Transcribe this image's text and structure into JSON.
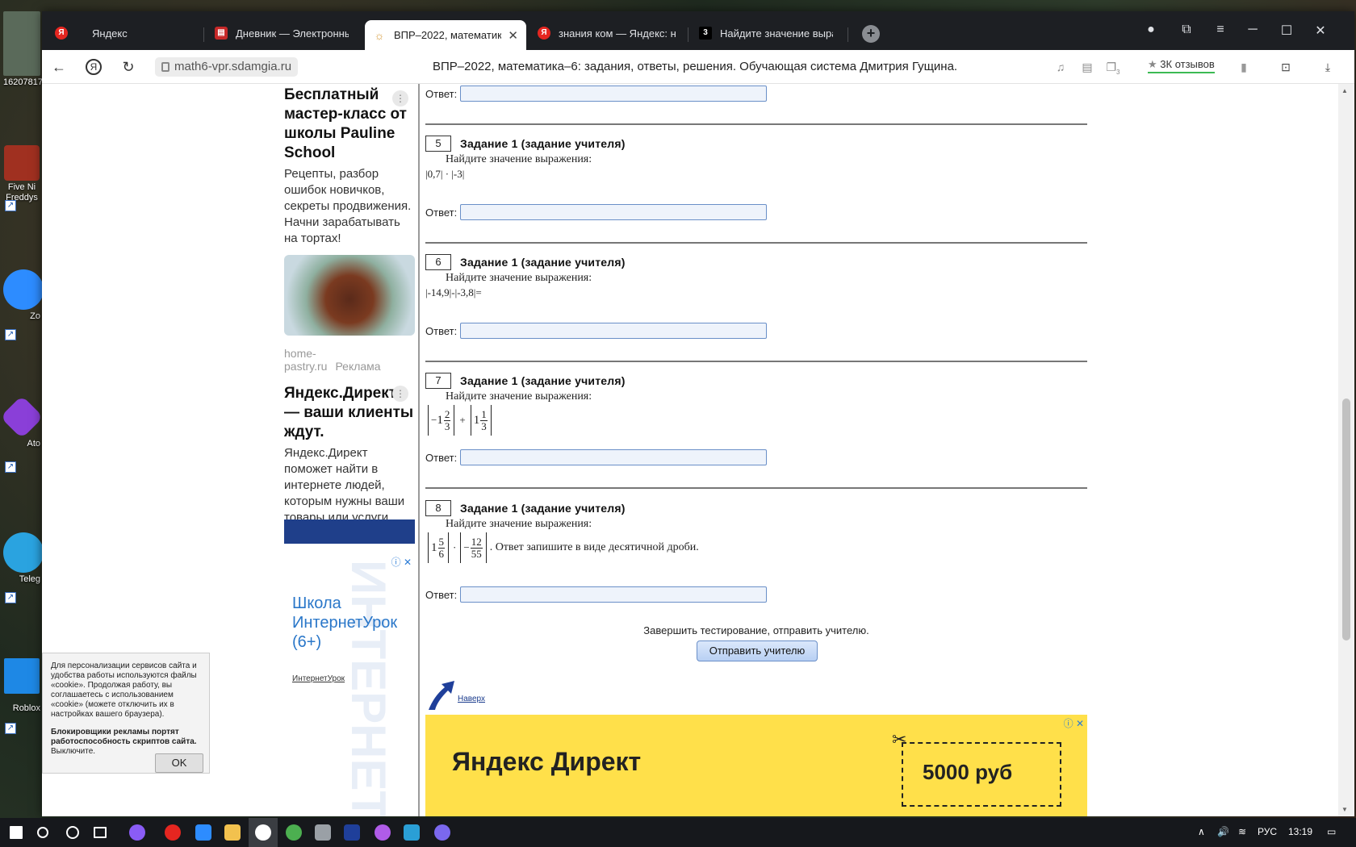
{
  "desktop": {
    "icons": [
      {
        "label": "16207817"
      },
      {
        "label": "Five Ni Freddys"
      },
      {
        "label": "Zo"
      },
      {
        "label": "Ato"
      },
      {
        "label": "Teleg"
      },
      {
        "label": "Roblox"
      }
    ]
  },
  "browser": {
    "tabs": [
      {
        "title": "Яндекс",
        "favicon_color": "#e52620",
        "favicon_glyph": "Я"
      },
      {
        "title": "Дневник — Электронный",
        "favicon_color": "#c62828",
        "favicon_glyph": "▤"
      },
      {
        "title": "ВПР–2022, математика–",
        "favicon_color": "#d59a3a",
        "favicon_glyph": "☼",
        "active": true,
        "close": "✕"
      },
      {
        "title": "знания ком — Яндекс: на",
        "favicon_color": "#e52620",
        "favicon_glyph": "Я"
      },
      {
        "title": "Найдите значение выраж",
        "favicon_color": "#1d1f23",
        "favicon_glyph": "3"
      }
    ],
    "newtab_glyph": "+",
    "url": "math6-vpr.sdamgia.ru",
    "page_title": "ВПР–2022, математика–6: задания, ответы, решения. Обучающая система Дмитрия Гущина.",
    "reviews": "3К отзывов",
    "tab_counter": "3"
  },
  "ads_left": {
    "ad1": {
      "title": "Бесплатный мастер-класс от школы Pauline School",
      "text": "Рецепты, разбор ошибок новичков, секреты продвижения. Начни зарабатывать на тортах!",
      "source": "home-pastry.ru",
      "label": "Реклама"
    },
    "ad2": {
      "title": "Яндекс.Директ — ваши клиенты ждут.",
      "text": "Яндекс.Директ поможет найти в интернете людей, которым нужны ваши товары или услуги."
    },
    "ad3": {
      "title": "Школа ИнтернетУрок (6+)",
      "source": "ИнтернетУрок"
    }
  },
  "cookie": {
    "text": "Для персонализации сервисов сайта и удобства работы используются файлы «cookie». Продолжая работу, вы соглашаетесь с использованием «cookie» (можете отключить их в настройках вашего браузера).",
    "bold_text": "Блокировщики рекламы портят работоспособность скриптов сайта.",
    "bold_suffix": "Выключите.",
    "ok": "OK"
  },
  "tasks": {
    "answer_label": "Ответ:",
    "items": [
      {
        "num": "5",
        "head": "Задание 1  (задание учителя)",
        "question": "Найдите значение выражения:",
        "expr": "|0,7|  ·  |-3|"
      },
      {
        "num": "6",
        "head": "Задание 1  (задание учителя)",
        "question": "Найдите значение выражения:",
        "expr": "|-14,9|-|-3,8|="
      },
      {
        "num": "7",
        "head": "Задание 1  (задание учителя)",
        "question": "Найдите значение выражения:"
      },
      {
        "num": "8",
        "head": "Задание 1  (задание учителя)",
        "question": "Найдите значение выражения:",
        "suffix": ". Ответ запишите в виде десятичной дроби."
      }
    ],
    "fractions": {
      "t7_whole1": "1",
      "t7_num1": "2",
      "t7_den1": "3",
      "t7_sign1": "−",
      "t7_plus": "+",
      "t7_whole2": "1",
      "t7_num2": "1",
      "t7_den2": "3",
      "t8_whole1": "1",
      "t8_num1": "5",
      "t8_den1": "6",
      "t8_dot": "·",
      "t8_sign2": "−",
      "t8_num2": "12",
      "t8_den2": "55"
    },
    "finish_text": "Завершить тестирование, отправить учителю.",
    "send_button": "Отправить учителю",
    "top_link": "Наверх"
  },
  "banner": {
    "title": "Яндекс Директ",
    "price": "5000 руб"
  },
  "taskbar": {
    "language": "РУС",
    "time": "13:19"
  }
}
